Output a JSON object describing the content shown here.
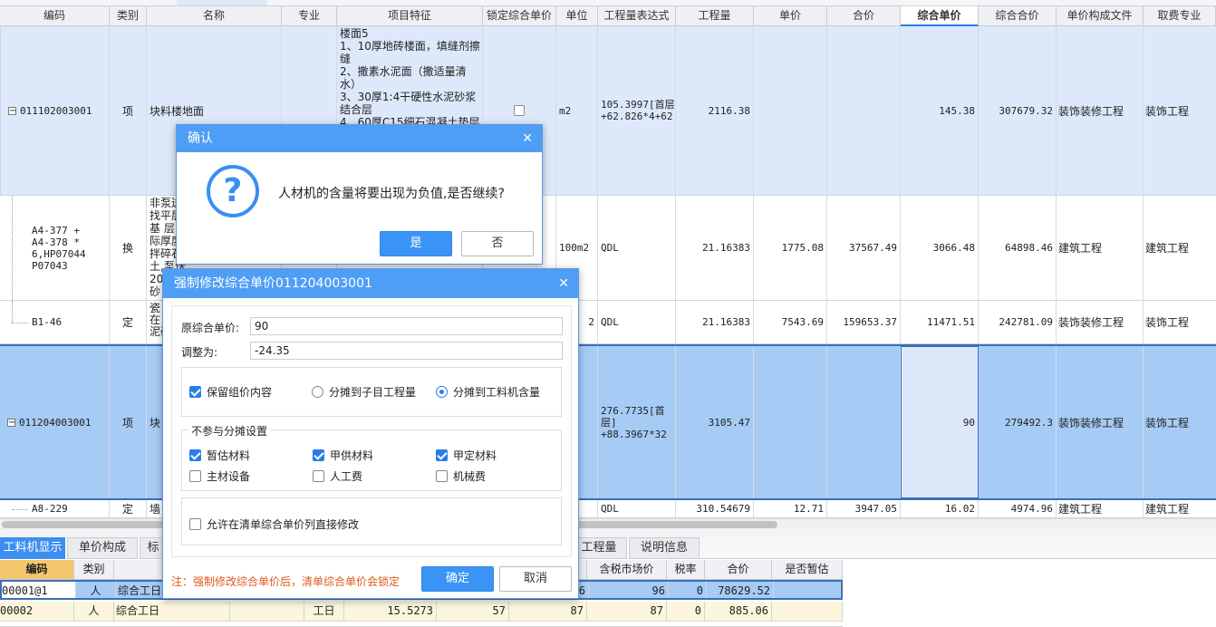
{
  "table": {
    "columns": [
      "编码",
      "类别",
      "名称",
      "专业",
      "项目特征",
      "锁定综合单价",
      "单位",
      "工程量表达式",
      "工程量",
      "单价",
      "合价",
      "综合单价",
      "综合合价",
      "单价构成文件",
      "取费专业"
    ],
    "rows": [
      {
        "code": "011102003001",
        "type": "项",
        "name": "块料楼地面",
        "features": "楼面5\n1、10厚地砖楼面，填缝剂擦缝\n2、撒素水泥面（撒适量清水）\n3、30厚1:4干硬性水泥砂浆结合层\n4、60厚C15细石混凝土垫层",
        "unit": "m2",
        "expr": "105.3997[首层]\n+62.826*4+62.8457*28",
        "qty": "2116.38",
        "price": "",
        "total": "",
        "uprice": "145.38",
        "utotal": "307679.32",
        "file": "装饰装修工程",
        "fee": "装饰工程"
      },
      {
        "code": "A4-377 +\nA4-378 *\n6,HP07044\nP07043",
        "type": "换",
        "name": "非泵送\n找平层\n基 层\n际厚度\n拌碎石\n土,泵送\n20mm\n砂",
        "unit": "100m2",
        "expr": "QDL",
        "qty": "21.16383",
        "price": "1775.08",
        "total": "37567.49",
        "uprice": "3066.48",
        "utotal": "64898.46",
        "file": "建筑工程",
        "fee": "建筑工程"
      },
      {
        "code": "B1-46",
        "type": "定",
        "name": "瓷\n在\n泥砂",
        "unit": "2",
        "expr": "QDL",
        "qty": "21.16383",
        "price": "7543.69",
        "total": "159653.37",
        "uprice": "11471.51",
        "utotal": "242781.09",
        "file": "装饰装修工程",
        "fee": "装饰工程"
      },
      {
        "code": "011204003001",
        "type": "项",
        "name": "块",
        "unit": "",
        "expr": "276.7735[首\n层]\n+88.3967*32",
        "qty": "3105.47",
        "price": "",
        "total": "",
        "uprice": "90",
        "utotal": "279492.3",
        "file": "装饰装修工程",
        "fee": "装饰工程"
      },
      {
        "code": "A8-229",
        "type": "定",
        "name": "墙",
        "unit": "",
        "expr": "QDL",
        "qty": "310.54679",
        "price": "12.71",
        "total": "3947.05",
        "uprice": "16.02",
        "utotal": "4974.96",
        "file": "建筑工程",
        "fee": "建筑工程"
      }
    ]
  },
  "tabs": [
    "工料机显示",
    "单价构成",
    "标",
    "工程量",
    "说明信息"
  ],
  "bottom": {
    "columns": [
      "编码",
      "类别",
      "",
      "",
      "",
      "",
      "",
      "含税市场价",
      "税率",
      "合价",
      "是否暂估"
    ],
    "rows": [
      {
        "code": "00001@1",
        "type": "人",
        "name": "综合工日",
        "unit": "",
        "qty": "",
        "p1": "",
        "p2": "6",
        "market": "96",
        "tax": "0",
        "total": "78629.52"
      },
      {
        "code": "00002",
        "type": "人",
        "name": "综合工日",
        "unit": "工日",
        "qty": "15.5273",
        "p1": "57",
        "p2": "87",
        "market": "87",
        "tax": "0",
        "total": "885.06"
      }
    ]
  },
  "confirm": {
    "title": "确认",
    "message": "人材机的含量将要出现为负值,是否继续?",
    "yes": "是",
    "no": "否"
  },
  "force": {
    "title": "强制修改综合单价011204003001",
    "orig_label": "原综合单价:",
    "orig_value": "90",
    "adjust_label": "调整为:",
    "adjust_value": "-24.35",
    "keep_label": "保留组价内容",
    "radio1": "分摊到子目工程量",
    "radio2": "分摊到工料机含量",
    "exclude_title": "不参与分摊设置",
    "ex1": "暂估材料",
    "ex2": "甲供材料",
    "ex3": "甲定材料",
    "ex4": "主材设备",
    "ex5": "人工费",
    "ex6": "机械费",
    "allow_label": "允许在清单综合单价列直接修改",
    "note": "注：强制修改综合单价后，清单综合单价会锁定",
    "ok": "确定",
    "cancel": "取消"
  }
}
